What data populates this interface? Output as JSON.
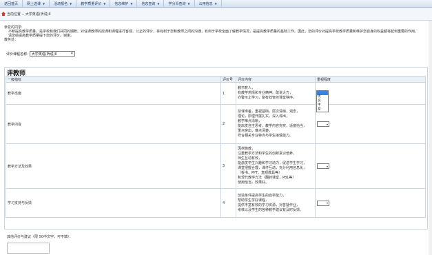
{
  "nav": {
    "items": [
      {
        "label": "返回首页",
        "dropdown": false
      },
      {
        "label": "网上选课",
        "dropdown": true
      },
      {
        "label": "活动报名",
        "dropdown": true
      },
      {
        "label": "教学质量评价",
        "dropdown": true
      },
      {
        "label": "信息维护",
        "dropdown": true
      },
      {
        "label": "信息查询",
        "dropdown": true
      },
      {
        "label": "学分币查询",
        "dropdown": true
      },
      {
        "label": "公用信息",
        "dropdown": true
      }
    ]
  },
  "breadcrumb": "当前位置 -- 大学英语(听说)II",
  "notice": {
    "greeting": "亲爱的同学:",
    "body": "不断提高教学质量，是学校和我们共同的期盼。对任课教师的授课和课程进行客观、公正的评价，将有利于您和教师之间的沟通，有利于学校全面了解教学情况，是提高教学质量的基础工作。因此，您的评价对提高学校教学质量和维护您自身的权益都将起到重要的作用。",
    "line2": "请您给提高教学质量提下您的评价。谢谢。",
    "section_label": "教务处："
  },
  "course": {
    "label": "评价课程名称:",
    "selected": "大学英语(听说)II"
  },
  "panel": {
    "title": "评教师"
  },
  "table": {
    "headers": [
      "一级指标",
      "评价号",
      "评价内容",
      "重视程度"
    ],
    "rows": [
      {
        "indicator": "教学态度",
        "number": "1",
        "lines": [
          "教书育人，",
          "有教学热情和专业精神。敢说大方，",
          "亦警示止学习，能有效管控课堂秩序。"
        ],
        "rating": ""
      },
      {
        "indicator": "教学内容",
        "number": "2",
        "lines": [
          "授课准备，重视基础，层次清晰，观念，",
          "理论，原理开展扎实，深入浅出，",
          "教学难点清晰，",
          "能启发自主思考，教学内容充实，适度恰当，",
          "重点突出，难点清楚，",
          "符合相关专业特点与学生接受能力。"
        ],
        "rating": ""
      },
      {
        "indicator": "教学方法及效果",
        "number": "3",
        "lines": [
          "因材施教，",
          "注重教学方法和学生的创新意识培养，",
          "师生互动有效，",
          "能激发学生兴趣和学习动力，促进学生学习，",
          "课堂把握合理，课件互动，充分利用信息化，",
          "（板书、PPT、直观教具等）",
          "和现代教学方法（翻转课堂，PBL等）",
          "使用恰当，效果好。"
        ],
        "rating": ""
      },
      {
        "indicator": "学习支持与反馈",
        "number": "4",
        "lines": [
          "创造条件提高学生的自学能力，",
          "帮助学生学好课程，",
          "提供丰富有效的学习资源，对答疑作业，",
          "考核以及学生的各种教学建议有及时反馈。"
        ],
        "rating": ""
      }
    ]
  },
  "rating_options": [
    "",
    "优",
    "良",
    "中",
    "差"
  ],
  "suggestion": {
    "label": "其他评价与建议（限 50中文字，可不填）："
  },
  "colors": {
    "nav_bg": "#d3e2f2",
    "nav_text": "#173a6b",
    "header_bg": "#eaf0f7",
    "border": "#c9d4e0",
    "highlight": "#3b82e0"
  }
}
